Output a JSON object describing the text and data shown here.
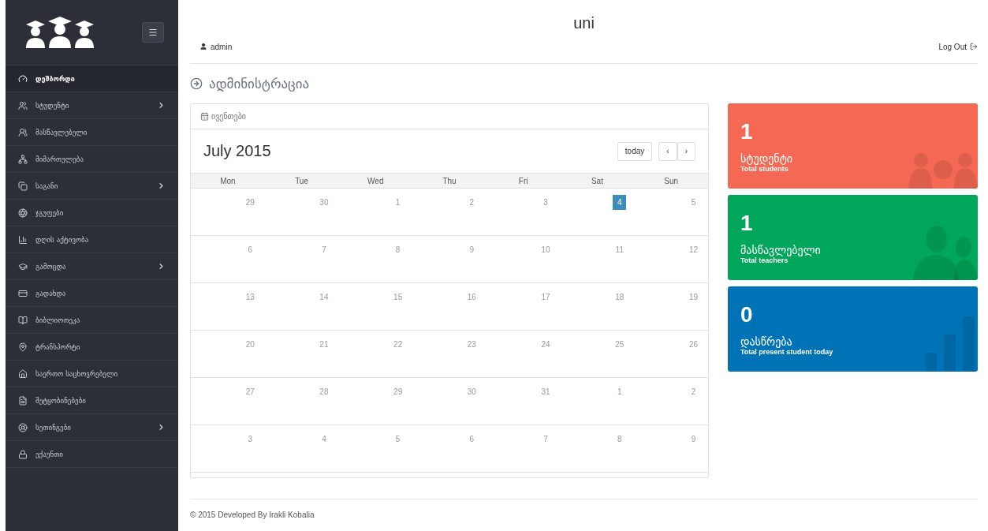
{
  "sidebar": {
    "items": [
      {
        "label": "დეშბორდი",
        "selected": true,
        "submenu": false
      },
      {
        "label": "სტუდენტი",
        "selected": false,
        "submenu": true
      },
      {
        "label": "მასწავლებელი",
        "selected": false,
        "submenu": false
      },
      {
        "label": "მიმართულება",
        "selected": false,
        "submenu": false
      },
      {
        "label": "საგანი",
        "selected": false,
        "submenu": true
      },
      {
        "label": "ჯგუფები",
        "selected": false,
        "submenu": false
      },
      {
        "label": "დღის აქტივობა",
        "selected": false,
        "submenu": false
      },
      {
        "label": "გამოცდა",
        "selected": false,
        "submenu": true
      },
      {
        "label": "გადახდა",
        "selected": false,
        "submenu": false
      },
      {
        "label": "ბიბლიოთეკა",
        "selected": false,
        "submenu": false
      },
      {
        "label": "ტრანსპორტი",
        "selected": false,
        "submenu": false
      },
      {
        "label": "საერთო საცხოვრებელი",
        "selected": false,
        "submenu": false
      },
      {
        "label": "შეტყობინებები",
        "selected": false,
        "submenu": false
      },
      {
        "label": "სეთინგები",
        "selected": false,
        "submenu": true
      },
      {
        "label": "ექაუნთი",
        "selected": false,
        "submenu": false
      }
    ]
  },
  "header": {
    "title": "uni",
    "user": "admin",
    "logout": "Log Out"
  },
  "page_title": "ადმინისტრაცია",
  "calendar": {
    "panel_title": "ივენთები",
    "month": "July 2015",
    "today_button": "today",
    "prev": "‹",
    "next": "›",
    "weekdays": [
      "Mon",
      "Tue",
      "Wed",
      "Thu",
      "Fri",
      "Sat",
      "Sun"
    ],
    "weeks": [
      [
        {
          "day": "29",
          "today": false
        },
        {
          "day": "30",
          "today": false
        },
        {
          "day": "1",
          "today": false
        },
        {
          "day": "2",
          "today": false
        },
        {
          "day": "3",
          "today": false
        },
        {
          "day": "4",
          "today": true
        },
        {
          "day": "5",
          "today": false
        }
      ],
      [
        {
          "day": "6",
          "today": false
        },
        {
          "day": "7",
          "today": false
        },
        {
          "day": "8",
          "today": false
        },
        {
          "day": "9",
          "today": false
        },
        {
          "day": "10",
          "today": false
        },
        {
          "day": "11",
          "today": false
        },
        {
          "day": "12",
          "today": false
        }
      ],
      [
        {
          "day": "13",
          "today": false
        },
        {
          "day": "14",
          "today": false
        },
        {
          "day": "15",
          "today": false
        },
        {
          "day": "16",
          "today": false
        },
        {
          "day": "17",
          "today": false
        },
        {
          "day": "18",
          "today": false
        },
        {
          "day": "19",
          "today": false
        }
      ],
      [
        {
          "day": "20",
          "today": false
        },
        {
          "day": "21",
          "today": false
        },
        {
          "day": "22",
          "today": false
        },
        {
          "day": "23",
          "today": false
        },
        {
          "day": "24",
          "today": false
        },
        {
          "day": "25",
          "today": false
        },
        {
          "day": "26",
          "today": false
        }
      ],
      [
        {
          "day": "27",
          "today": false
        },
        {
          "day": "28",
          "today": false
        },
        {
          "day": "29",
          "today": false
        },
        {
          "day": "30",
          "today": false
        },
        {
          "day": "31",
          "today": false
        },
        {
          "day": "1",
          "today": false
        },
        {
          "day": "2",
          "today": false
        }
      ],
      [
        {
          "day": "3",
          "today": false
        },
        {
          "day": "4",
          "today": false
        },
        {
          "day": "5",
          "today": false
        },
        {
          "day": "6",
          "today": false
        },
        {
          "day": "7",
          "today": false
        },
        {
          "day": "8",
          "today": false
        },
        {
          "day": "9",
          "today": false
        }
      ]
    ]
  },
  "stats": [
    {
      "kind": "students",
      "value": "1",
      "label": "სტუდენტი",
      "caption": "Total students",
      "color": "#f56954"
    },
    {
      "kind": "teachers",
      "value": "1",
      "label": "მასწავლებელი",
      "caption": "Total teachers",
      "color": "#00a65a"
    },
    {
      "kind": "attendance",
      "value": "0",
      "label": "დასწრება",
      "caption": "Total present student today",
      "color": "#0073b7"
    }
  ],
  "footer": "© 2015 Developed By Irakli Kobalia"
}
